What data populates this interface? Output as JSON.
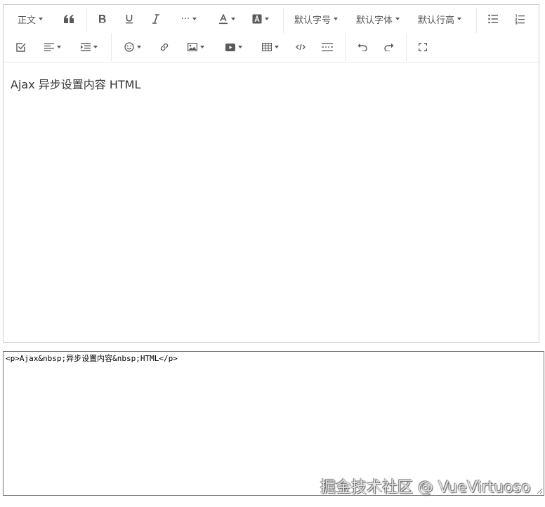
{
  "toolbar": {
    "heading_select": "正文",
    "font_size_select": "默认字号",
    "font_family_select": "默认字体",
    "line_height_select": "默认行高",
    "more_label": "···",
    "font_color_label": "A",
    "bg_color_label": "A"
  },
  "icons": [
    "paragraph-format-icon",
    "blockquote-icon",
    "bold-icon",
    "underline-icon",
    "italic-icon",
    "more-icon",
    "font-color-icon",
    "background-color-icon",
    "bulleted-list-icon",
    "numbered-list-icon",
    "todo-icon",
    "align-icon",
    "indent-icon",
    "emotion-icon",
    "link-icon",
    "image-icon",
    "video-icon",
    "table-icon",
    "code-block-icon",
    "divider-icon",
    "undo-icon",
    "redo-icon",
    "fullscreen-icon"
  ],
  "editor": {
    "content": "Ajax 异步设置内容 HTML"
  },
  "source_textarea": {
    "value": "<p>Ajax&nbsp;异步设置内容&nbsp;HTML</p>"
  },
  "watermark": "掘金技术社区 @ VueVirtuoso",
  "colors": {
    "border": "#cccccc",
    "icon": "#595959",
    "text": "#333333"
  }
}
